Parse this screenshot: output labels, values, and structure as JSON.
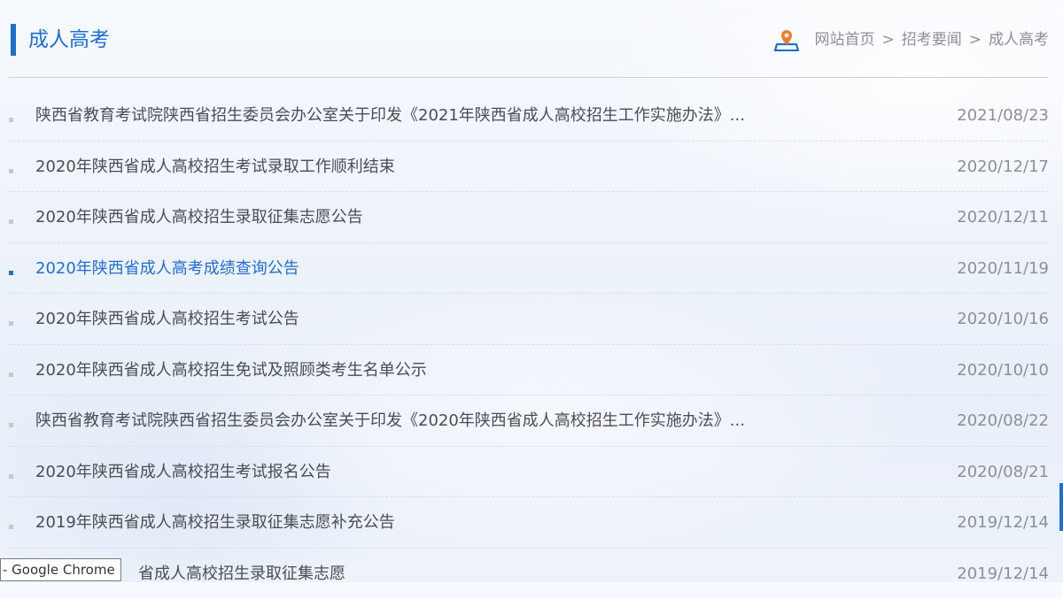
{
  "header": {
    "title": "成人高考",
    "breadcrumb": {
      "icon": "location-pin-icon",
      "items": [
        "网站首页",
        "招考要闻",
        "成人高考"
      ],
      "separator": ">"
    }
  },
  "news": [
    {
      "title": "陕西省教育考试院陕西省招生委员会办公室关于印发《2021年陕西省成人高校招生工作实施办法》...",
      "date": "2021/08/23"
    },
    {
      "title": "2020年陕西省成人高校招生考试录取工作顺利结束",
      "date": "2020/12/17"
    },
    {
      "title": "2020年陕西省成人高校招生录取征集志愿公告",
      "date": "2020/12/11"
    },
    {
      "title": "2020年陕西省成人高考成绩查询公告",
      "date": "2020/11/19"
    },
    {
      "title": "2020年陕西省成人高校招生考试公告",
      "date": "2020/10/16"
    },
    {
      "title": "2020年陕西省成人高校招生免试及照顾类考生名单公示",
      "date": "2020/10/10"
    },
    {
      "title": "陕西省教育考试院陕西省招生委员会办公室关于印发《2020年陕西省成人高校招生工作实施办法》...",
      "date": "2020/08/22"
    },
    {
      "title": "2020年陕西省成人高校招生考试报名公告",
      "date": "2020/08/21"
    },
    {
      "title": "2019年陕西省成人高校招生录取征集志愿补充公告",
      "date": "2019/12/14"
    },
    {
      "title": "省成人高校招生录取征集志愿",
      "date": "2019/12/14"
    }
  ],
  "active_index": 3,
  "tooltip": "- Google Chrome",
  "colors": {
    "accent": "#1f6fd1",
    "text": "#4a4d53",
    "muted": "#8c8f96",
    "pin_orange": "#f07a23"
  }
}
